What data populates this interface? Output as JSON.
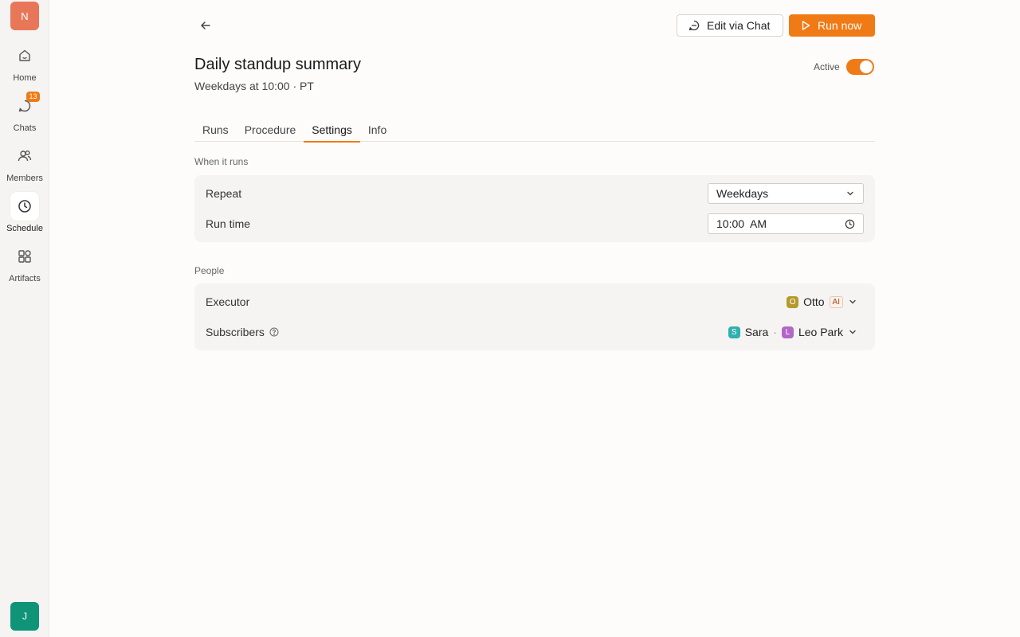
{
  "workspace": {
    "initial": "N"
  },
  "nav": {
    "items": [
      {
        "label": "Home",
        "icon": "home-icon"
      },
      {
        "label": "Chats",
        "icon": "chat-icon",
        "badge": "13"
      },
      {
        "label": "Members",
        "icon": "members-icon"
      },
      {
        "label": "Schedule",
        "icon": "clock-icon",
        "active": true
      },
      {
        "label": "Artifacts",
        "icon": "artifacts-icon"
      }
    ]
  },
  "user": {
    "initial": "J"
  },
  "header": {
    "edit_label": "Edit via Chat",
    "run_label": "Run now",
    "title": "Daily standup summary",
    "subtitle": "Weekdays at 10:00 · PT",
    "active_label": "Active",
    "active": true
  },
  "tabs": [
    {
      "label": "Runs"
    },
    {
      "label": "Procedure"
    },
    {
      "label": "Settings",
      "active": true
    },
    {
      "label": "Info"
    }
  ],
  "when": {
    "section_label": "When it runs",
    "repeat_label": "Repeat",
    "repeat_value": "Weekdays",
    "runtime_label": "Run time",
    "runtime_value": "10:00  AM"
  },
  "people": {
    "section_label": "People",
    "executor_label": "Executor",
    "executor": {
      "initial": "O",
      "name": "Otto",
      "badge": "AI"
    },
    "subscribers_label": "Subscribers",
    "subscribers": [
      {
        "initial": "S",
        "name": "Sara"
      },
      {
        "initial": "L",
        "name": "Leo Park"
      }
    ],
    "separator": "·"
  },
  "colors": {
    "accent": "#f07a16",
    "workspace_avatar": "#e8775a",
    "user_avatar": "#0f9478",
    "otto_avatar": "#b49a2c",
    "sara_avatar": "#2fb0b0",
    "leo_avatar": "#b266c8"
  }
}
